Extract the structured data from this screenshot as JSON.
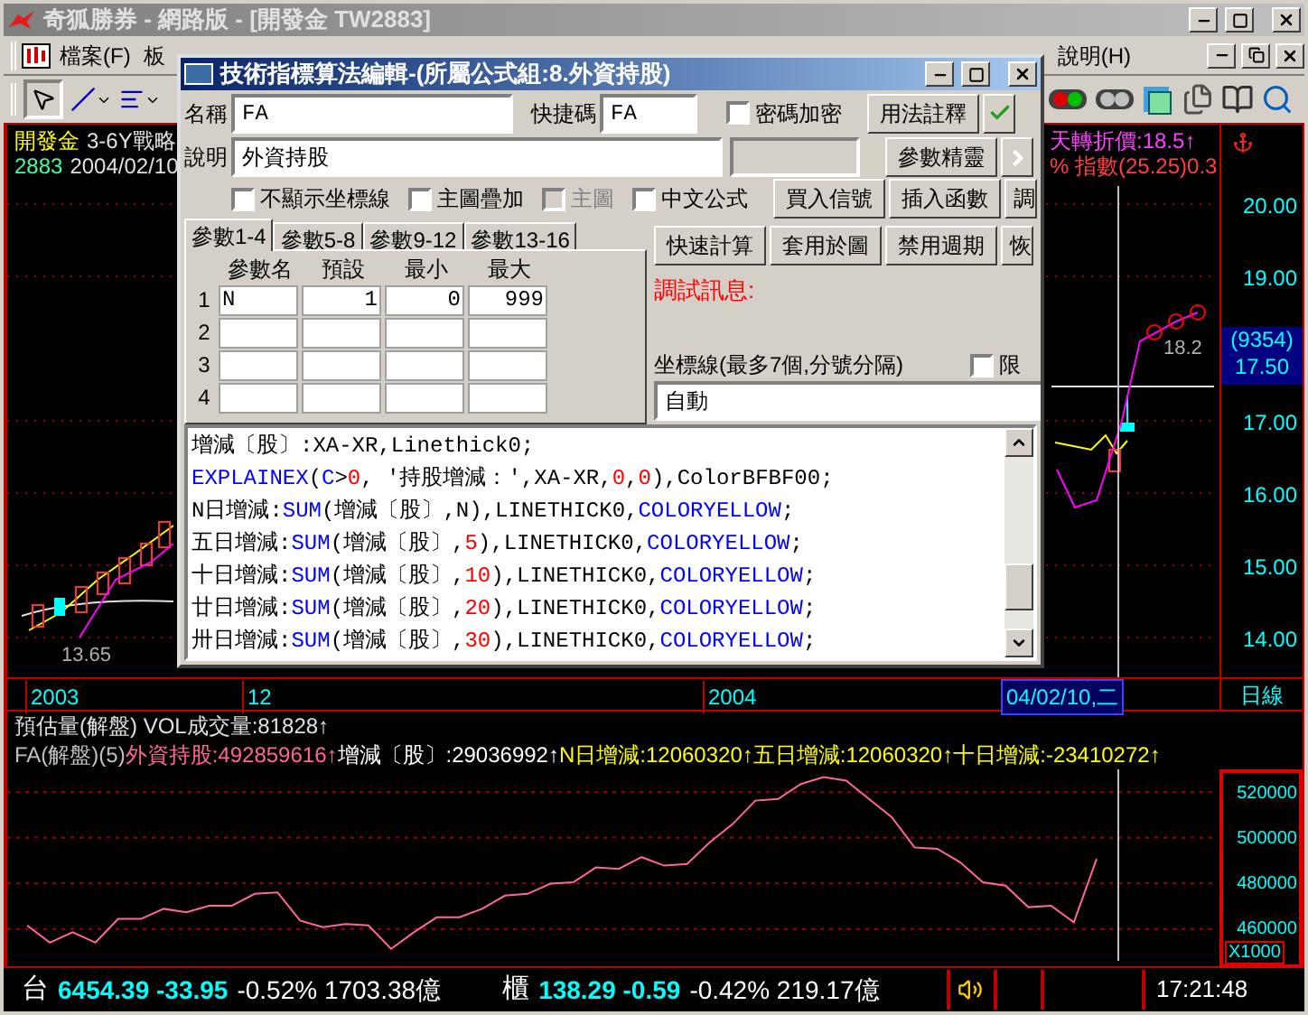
{
  "window": {
    "title": "奇狐勝券 - 網路版 - [開發金 TW2883]"
  },
  "menu": {
    "items": [
      "檔案(F)",
      "板"
    ],
    "help": "說明(H)"
  },
  "price_chart": {
    "stock_name": "開發金",
    "strategy": "3-6Y戰略",
    "code": "2883",
    "date": "2004/02/10",
    "indicator_1": "天轉折價:18.5↑",
    "indicator_2": "% 指數(25.25)0.3",
    "price_labels": [
      "20.00",
      "19.00",
      "17.00",
      "16.00",
      "15.00",
      "14.00"
    ],
    "marker_labels": [
      "18.2",
      "13.65"
    ],
    "current_volume": "(9354)",
    "current_price": "17.50"
  },
  "date_axis": {
    "labels": [
      "2003",
      "12",
      "2004"
    ],
    "current_date": "04/02/10,二",
    "period": "日線"
  },
  "lower_panel": {
    "header": "預估量(解盤) VOL成交量:81828↑",
    "legend": [
      {
        "text": "FA(解盤)(5)",
        "color": "#c0c0c0"
      },
      {
        "text": "外資持股:492859616↑",
        "color": "#ff6699"
      },
      {
        "text": "增減〔股〕:29036992↑",
        "color": "#ffffff"
      },
      {
        "text": "N日增減:12060320↑",
        "color": "#ffff00"
      },
      {
        "text": "五日增減:12060320↑",
        "color": "#ffff00"
      },
      {
        "text": "十日增減:-23410272↑",
        "color": "#ffff00"
      }
    ],
    "multiplier": "X1000",
    "chart_data": {
      "type": "line",
      "grid": true,
      "ylim": [
        446000,
        530000
      ],
      "yticks": [
        {
          "value": 460000,
          "label": "460000"
        },
        {
          "value": 480000,
          "label": "480000"
        },
        {
          "value": 500000,
          "label": "500000"
        },
        {
          "value": 520000,
          "label": "520000"
        }
      ],
      "series": [
        {
          "color": "#ff6699",
          "values": [
            461500,
            454000,
            458500,
            454000,
            464400,
            464400,
            468800,
            467300,
            470200,
            470200,
            475400,
            476000,
            463700,
            460700,
            462200,
            461500,
            451200,
            458500,
            465100,
            465100,
            468800,
            474600,
            475400,
            479800,
            480500,
            487000,
            486300,
            491500,
            487800,
            488500,
            498000,
            506000,
            516300,
            517000,
            523600,
            526600,
            525100,
            517000,
            509000,
            495800,
            495100,
            489300,
            480500,
            479000,
            469500,
            470200,
            462900,
            490700
          ]
        }
      ]
    }
  },
  "status_bar": {
    "markets": [
      {
        "name": "台",
        "quote": "6454.39 -33.95",
        "change": "-0.52% 1703.38億"
      },
      {
        "name": "櫃",
        "quote": "138.29 -0.59",
        "change": "-0.42% 219.17億"
      }
    ],
    "time": "17:21:48"
  },
  "dialog": {
    "title": "技術指標算法編輯-(所屬公式組:8.外資持股)",
    "name_label": "名稱",
    "name_value": "FA",
    "shortcut_label": "快捷碼",
    "shortcut_value": "FA",
    "password": {
      "label": "密碼加密",
      "checked": false
    },
    "desc_label": "說明",
    "desc_value": "外資持股",
    "usage_button": "用法註釋",
    "wizard_button": "參數精靈",
    "checkboxes": [
      {
        "label": "不顯示坐標線",
        "checked": false,
        "disabled": false
      },
      {
        "label": "主圖疊加",
        "checked": false,
        "disabled": false
      },
      {
        "label": "主圖",
        "checked": false,
        "disabled": true
      },
      {
        "label": "中文公式",
        "checked": false,
        "disabled": false
      }
    ],
    "buttons_row_1": [
      "買入信號",
      "插入函數",
      "調"
    ],
    "buttons_row_2": [
      "快速計算",
      "套用於圖",
      "禁用週期",
      "恢"
    ],
    "tabs": [
      {
        "label": "參數1-4",
        "selected": true
      },
      {
        "label": "參數5-8",
        "selected": false
      },
      {
        "label": "參數9-12",
        "selected": false
      },
      {
        "label": "參數13-16",
        "selected": false
      }
    ],
    "param_columns": [
      "參數名",
      "預設",
      "最小",
      "最大"
    ],
    "param_rows": [
      {
        "index": "1",
        "cells": [
          "N",
          "1",
          "0",
          "999"
        ]
      },
      {
        "index": "2"
      },
      {
        "index": "3"
      },
      {
        "index": "4"
      }
    ],
    "debug_label": "調試訊息:",
    "axis_lines": {
      "label": "坐標線(最多7個,分號分隔)",
      "limit": {
        "label": "限",
        "checked": false
      },
      "value": "自動"
    },
    "code": [
      [
        {
          "kind": "text",
          "text": "增減〔股〕:XA-XR,Linethick0;"
        }
      ],
      [
        {
          "kind": "func",
          "text": "EXPLAINEX"
        },
        {
          "kind": "text",
          "text": "("
        },
        {
          "kind": "func",
          "text": "C"
        },
        {
          "kind": "text",
          "text": ">"
        },
        {
          "kind": "num",
          "text": "0"
        },
        {
          "kind": "text",
          "text": ", '持股增減：',XA-XR,"
        },
        {
          "kind": "num",
          "text": "0"
        },
        {
          "kind": "text",
          "text": ","
        },
        {
          "kind": "num",
          "text": "0"
        },
        {
          "kind": "text",
          "text": "),ColorBFBF00;"
        }
      ],
      [
        {
          "kind": "text",
          "text": "N日增減:"
        },
        {
          "kind": "func",
          "text": "SUM"
        },
        {
          "kind": "text",
          "text": "(增減〔股〕,N),LINETHICK0,"
        },
        {
          "kind": "func",
          "text": "COLORYELLOW"
        },
        {
          "kind": "text",
          "text": ";"
        }
      ],
      [
        {
          "kind": "text",
          "text": "五日增減:"
        },
        {
          "kind": "func",
          "text": "SUM"
        },
        {
          "kind": "text",
          "text": "(增減〔股〕,"
        },
        {
          "kind": "num",
          "text": "5"
        },
        {
          "kind": "text",
          "text": "),LINETHICK0,"
        },
        {
          "kind": "func",
          "text": "COLORYELLOW"
        },
        {
          "kind": "text",
          "text": ";"
        }
      ],
      [
        {
          "kind": "text",
          "text": "十日增減:"
        },
        {
          "kind": "func",
          "text": "SUM"
        },
        {
          "kind": "text",
          "text": "(增減〔股〕,"
        },
        {
          "kind": "num",
          "text": "10"
        },
        {
          "kind": "text",
          "text": "),LINETHICK0,"
        },
        {
          "kind": "func",
          "text": "COLORYELLOW"
        },
        {
          "kind": "text",
          "text": ";"
        }
      ],
      [
        {
          "kind": "text",
          "text": "廿日增減:"
        },
        {
          "kind": "func",
          "text": "SUM"
        },
        {
          "kind": "text",
          "text": "(增減〔股〕,"
        },
        {
          "kind": "num",
          "text": "20"
        },
        {
          "kind": "text",
          "text": "),LINETHICK0,"
        },
        {
          "kind": "func",
          "text": "COLORYELLOW"
        },
        {
          "kind": "text",
          "text": ";"
        }
      ],
      [
        {
          "kind": "text",
          "text": "卅日增減:"
        },
        {
          "kind": "func",
          "text": "SUM"
        },
        {
          "kind": "text",
          "text": "(增減〔股〕,"
        },
        {
          "kind": "num",
          "text": "30"
        },
        {
          "kind": "text",
          "text": "),LINETHICK0,"
        },
        {
          "kind": "func",
          "text": "COLORYELLOW"
        },
        {
          "kind": "text",
          "text": ";"
        }
      ]
    ]
  }
}
